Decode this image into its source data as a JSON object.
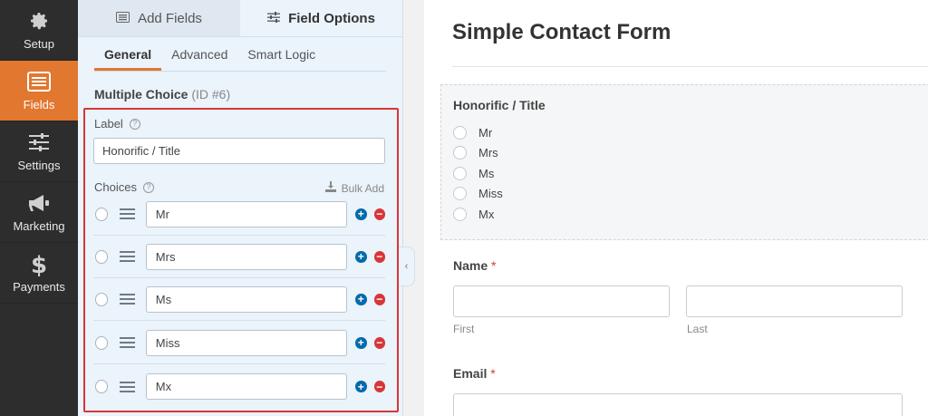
{
  "nav": {
    "items": [
      {
        "label": "Setup",
        "icon": "gear-icon"
      },
      {
        "label": "Fields",
        "icon": "fields-list-icon",
        "active": true
      },
      {
        "label": "Settings",
        "icon": "sliders-icon"
      },
      {
        "label": "Marketing",
        "icon": "megaphone-icon"
      },
      {
        "label": "Payments",
        "icon": "dollar-icon"
      }
    ]
  },
  "panel": {
    "tabs": {
      "add_fields": "Add Fields",
      "field_options": "Field Options"
    },
    "subtabs": {
      "general": "General",
      "advanced": "Advanced",
      "smart_logic": "Smart Logic"
    },
    "field_type": "Multiple Choice",
    "field_id": "(ID #6)",
    "label_caption": "Label",
    "label_value": "Honorific / Title",
    "choices_caption": "Choices",
    "bulk_add": "Bulk Add",
    "choices": [
      "Mr",
      "Mrs",
      "Ms",
      "Miss",
      "Mx"
    ]
  },
  "preview": {
    "form_title": "Simple Contact Form",
    "honorific_label": "Honorific / Title",
    "honorific_choices": [
      "Mr",
      "Mrs",
      "Ms",
      "Miss",
      "Mx"
    ],
    "name_label": "Name",
    "required_mark": "*",
    "first_sublabel": "First",
    "last_sublabel": "Last",
    "email_label": "Email"
  },
  "colors": {
    "accent": "#e27730",
    "highlight": "#d63638",
    "plus": "#036aab"
  }
}
